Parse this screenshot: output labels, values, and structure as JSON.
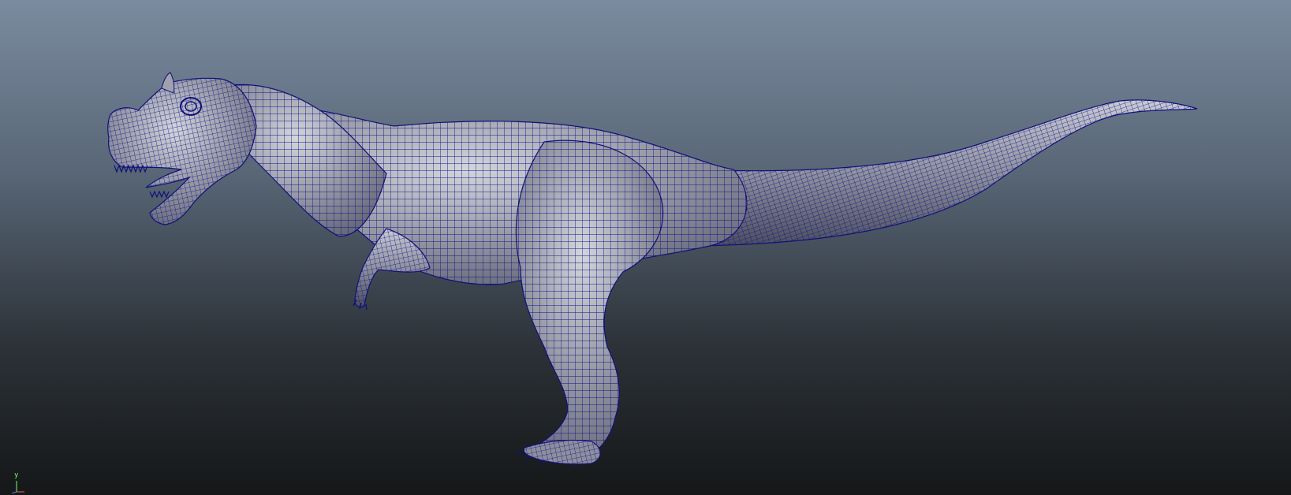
{
  "viewport": {
    "background_top": "#7a8a9e",
    "background_bottom": "#17191b",
    "wire_color": "#10107a",
    "surface_light": "#c9ccd4",
    "surface_mid": "#8c909b",
    "surface_dark": "#4a4d57"
  },
  "model": {
    "icon": "dinosaur-wireframe-model"
  },
  "axis": {
    "y_label": "y",
    "y_color": "#6cff6c",
    "x_color": "#ff5b5b",
    "z_color": "#5b7bff"
  }
}
